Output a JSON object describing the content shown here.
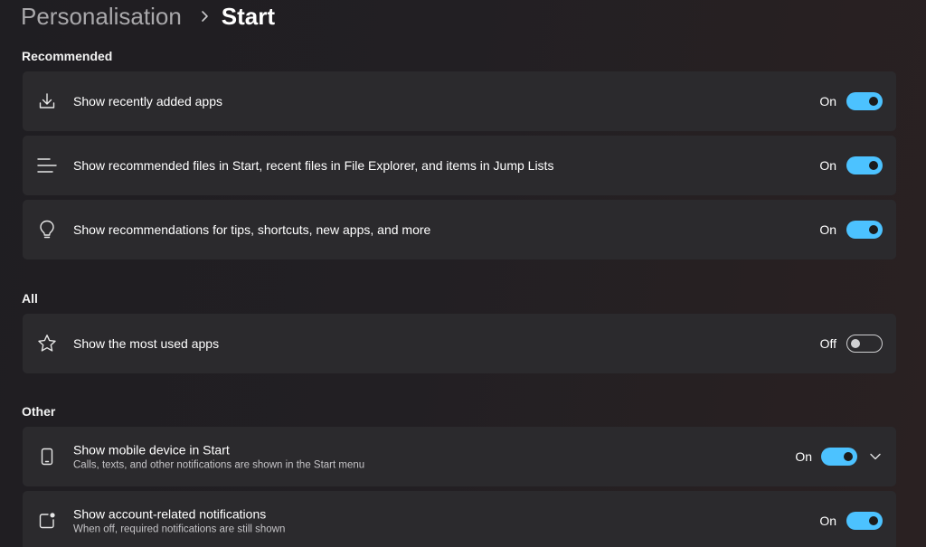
{
  "breadcrumb": {
    "parent": "Personalisation",
    "current": "Start"
  },
  "sections": {
    "recommended": "Recommended",
    "all": "All",
    "other": "Other"
  },
  "settings": {
    "recent_apps": {
      "label": "Show recently added apps",
      "state": "On",
      "icon": "download-icon"
    },
    "recommended_files": {
      "label": "Show recommended files in Start, recent files in File Explorer, and items in Jump Lists",
      "state": "On",
      "icon": "list-lines-icon"
    },
    "tips": {
      "label": "Show recommendations for tips, shortcuts, new apps, and more",
      "state": "On",
      "icon": "lightbulb-icon"
    },
    "most_used": {
      "label": "Show the most used apps",
      "state": "Off",
      "icon": "star-icon"
    },
    "mobile_device": {
      "label": "Show mobile device in Start",
      "description": "Calls, texts, and other notifications are shown in the Start menu",
      "state": "On",
      "icon": "phone-icon"
    },
    "account_notifications": {
      "label": "Show account-related notifications",
      "description": "When off, required notifications are still shown",
      "state": "On",
      "icon": "notification-badge-icon"
    }
  },
  "colors": {
    "accent": "#4cc2ff",
    "card": "#2b2a2d"
  }
}
